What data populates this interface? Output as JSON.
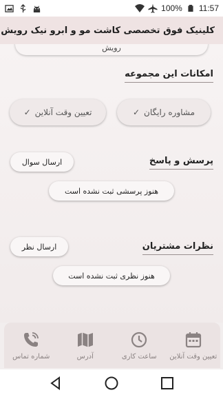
{
  "status_bar": {
    "battery": "100%",
    "time": "11:57"
  },
  "app": {
    "title": "کلینیک فوق تخصصی کاشت مو و ابرو نیک رویش"
  },
  "top_card": {
    "text": "رویش"
  },
  "features": {
    "title": "امکانات این مجموعه",
    "items": [
      {
        "label": "مشاوره رایگان"
      },
      {
        "label": "تعیین وقت آنلاین"
      }
    ]
  },
  "qa": {
    "title": "پرسش و پاسخ",
    "button": "ارسال سوال",
    "empty": "هنوز پرسشی ثبت نشده است"
  },
  "reviews": {
    "title": "نظرات مشتریان",
    "button": "ارسال نظر",
    "empty": "هنوز نظری ثبت نشده است"
  },
  "bottom_nav": [
    {
      "label": "تعیین وقت آنلاین",
      "icon": "calendar-icon"
    },
    {
      "label": "ساعت کاری",
      "icon": "clock-icon"
    },
    {
      "label": "آدرس",
      "icon": "map-icon"
    },
    {
      "label": "شماره تماس",
      "icon": "phone-icon"
    }
  ]
}
